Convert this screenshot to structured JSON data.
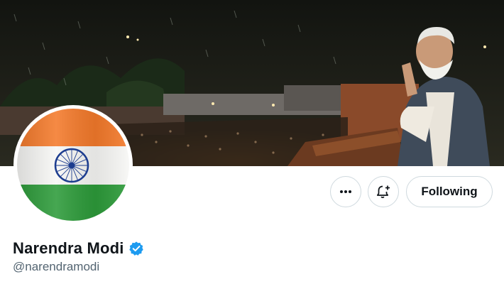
{
  "profile": {
    "display_name": "Narendra Modi",
    "handle": "@narendramodi",
    "verified": true,
    "avatar": "india-flag",
    "banner": "night-rally-crowd-photo"
  },
  "actions": {
    "more_icon": "more-dots-icon",
    "notify_icon": "bell-plus-icon",
    "follow_label": "Following"
  },
  "colors": {
    "verified_blue": "#1d9bf0",
    "text_primary": "#0f1419",
    "text_secondary": "#536471",
    "border": "#cfd9de",
    "saffron": "#f47a2b",
    "green": "#2d9b3a",
    "chakra_navy": "#1d3d8f"
  }
}
